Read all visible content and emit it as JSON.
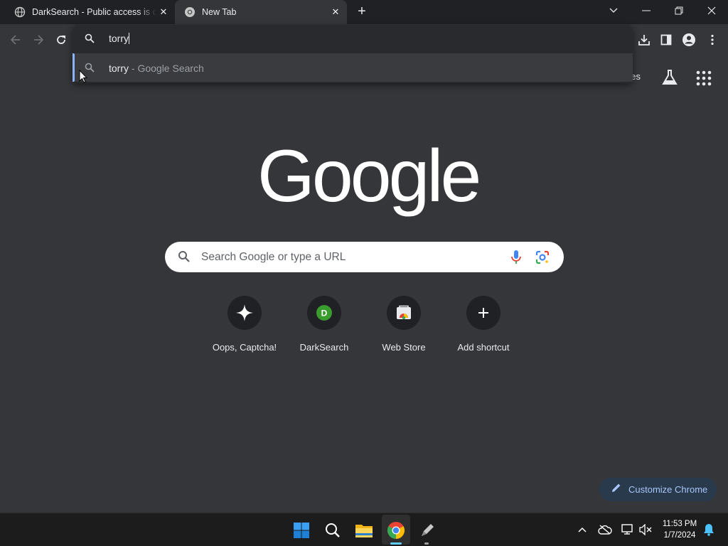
{
  "browser": {
    "tabs": [
      {
        "title": "DarkSearch - Public access is closed",
        "active": false
      },
      {
        "title": "New Tab",
        "active": true
      }
    ],
    "omnibox": {
      "input_value": "torry",
      "suggestion_query": "torry",
      "suggestion_source": " - Google Search"
    },
    "header_link": "ges"
  },
  "ntp": {
    "logo_text": "Google",
    "search_placeholder": "Search Google or type a URL",
    "shortcuts": [
      {
        "label": "Oops, Captcha!",
        "icon": "sparkle-icon"
      },
      {
        "label": "DarkSearch",
        "icon": "letter-d-icon",
        "letter": "D"
      },
      {
        "label": "Web Store",
        "icon": "web-store-icon"
      },
      {
        "label": "Add shortcut",
        "icon": "plus-icon"
      }
    ],
    "customize_label": "Customize Chrome"
  },
  "taskbar": {
    "time": "11:53 PM",
    "date": "1/7/2024"
  },
  "colors": {
    "ntp_background": "#35363a",
    "tabstrip": "#202124",
    "accent_blue": "#8ab4f8",
    "taskbar": "#1c1c1c"
  }
}
